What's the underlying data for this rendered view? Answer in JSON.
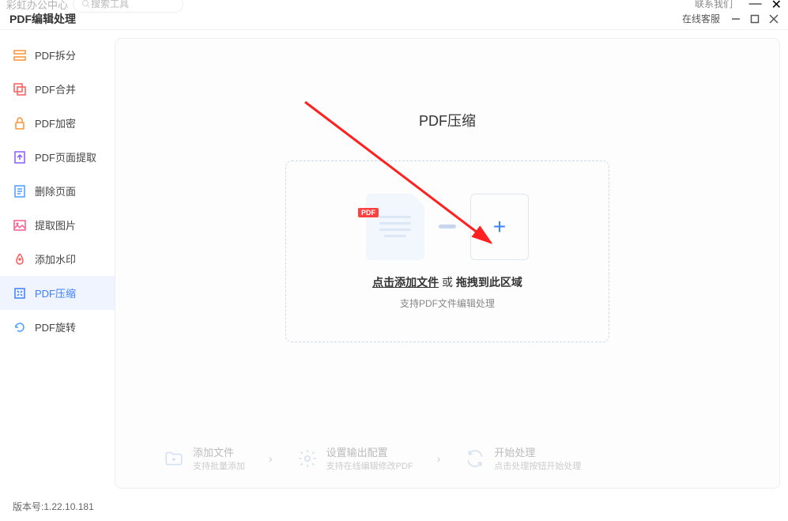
{
  "top": {
    "brand": "彩虹办公中心",
    "search_placeholder": "搜索工具",
    "contact": "联系我们"
  },
  "titlebar": {
    "section": "PDF编辑处理",
    "online_cs": "在线客服"
  },
  "sidebar": {
    "items": [
      {
        "id": "split",
        "label": "PDF拆分"
      },
      {
        "id": "merge",
        "label": "PDF合并"
      },
      {
        "id": "encrypt",
        "label": "PDF加密"
      },
      {
        "id": "extract-page",
        "label": "PDF页面提取"
      },
      {
        "id": "delete-page",
        "label": "删除页面"
      },
      {
        "id": "extract-image",
        "label": "提取图片"
      },
      {
        "id": "watermark",
        "label": "添加水印"
      },
      {
        "id": "compress",
        "label": "PDF压缩"
      },
      {
        "id": "rotate",
        "label": "PDF旋转"
      }
    ]
  },
  "content": {
    "title": "PDF压缩",
    "pdf_badge": "PDF",
    "click_add": "点击添加文件",
    "or": " 或 ",
    "drag_here": "拖拽到此区域",
    "support": "支持PDF文件编辑处理"
  },
  "steps": [
    {
      "title": "添加文件",
      "sub": "支持批量添加"
    },
    {
      "title": "设置输出配置",
      "sub": "支持在线编辑修改PDF"
    },
    {
      "title": "开始处理",
      "sub": "点击处理按钮开始处理"
    }
  ],
  "footer": {
    "version_label": "版本号:",
    "version": "1.22.10.181"
  }
}
